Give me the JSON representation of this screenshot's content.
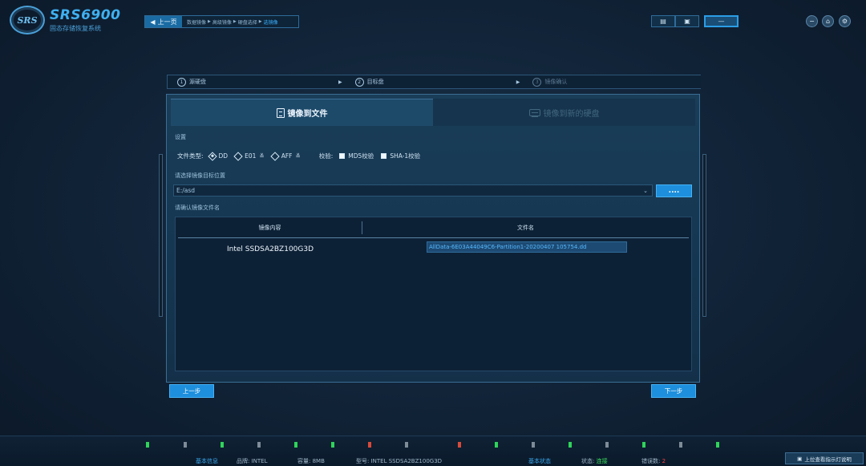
{
  "app": {
    "logo_mark": "SRS",
    "title": "SRS6900",
    "subtitle": "固态存储恢复系统"
  },
  "nav": {
    "back_label": "上一页",
    "breadcrumbs": [
      {
        "label": "数据镜像"
      },
      {
        "label": "高级镜像"
      },
      {
        "label": "硬盘选择"
      },
      {
        "label": "选镜像"
      }
    ]
  },
  "toolbar": {
    "report_icon": "report-icon",
    "case_icon": "case-icon",
    "minimize_icon": "minimize-icon",
    "home_icon": "home-icon",
    "settings_icon": "gear-icon"
  },
  "steps": [
    {
      "num": "1",
      "label": "源硬盘"
    },
    {
      "num": "2",
      "label": "目标盘"
    },
    {
      "num": "3",
      "label": "镜像确认"
    }
  ],
  "tabs": [
    {
      "label": "镜像到文件",
      "active": true
    },
    {
      "label": "镜像到新的硬盘",
      "active": false
    }
  ],
  "settings": {
    "section_label": "设置",
    "file_type_label": "文件类型:",
    "file_types": [
      {
        "label": "DD",
        "selected": true
      },
      {
        "label": "E01",
        "selected": false
      },
      {
        "label": "AFF",
        "selected": false
      }
    ],
    "verify_label": "校验:",
    "checks": [
      {
        "label": "MD5校验",
        "checked": false
      },
      {
        "label": "SHA-1校验",
        "checked": false
      }
    ]
  },
  "target": {
    "label": "请选择镜像目标位置",
    "path_value": "E:/asd",
    "browse_label": "...."
  },
  "table": {
    "label": "请确认镜像文件名",
    "columns": [
      "镜像内容",
      "文件名"
    ],
    "rows": [
      {
        "content": "Intel SSDSA2BZ100G3D",
        "filename": "AllData-6E03A44049C6-Partition1-20200407 105754.dd"
      }
    ]
  },
  "buttons": {
    "prev_label": "上一步",
    "next_label": "下一步"
  },
  "statusbar": {
    "basic_info_label": "基本信息",
    "brand_label": "品牌:",
    "brand_value": "INTEL",
    "capacity_label": "容量:",
    "capacity_value": "8MB",
    "model_label": "型号:",
    "model_value": "INTEL SSDSA2BZ100G3D",
    "basic_status_label": "基本状态",
    "state_label": "状态:",
    "state_value": "连接",
    "error_label": "错误数:",
    "error_value": "2",
    "help_label": "上拉查看指示灯说明",
    "colors": {
      "ok": "#3adc5a",
      "error": "#ff4040",
      "accent": "#3aa6ec"
    }
  }
}
